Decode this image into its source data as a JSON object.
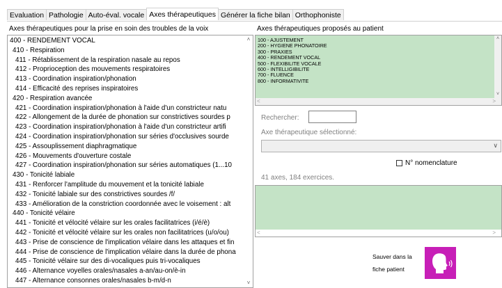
{
  "tabs": [
    {
      "label": "Evaluation",
      "active": false
    },
    {
      "label": "Pathologie",
      "active": false
    },
    {
      "label": "Auto-éval. vocale",
      "active": false
    },
    {
      "label": "Axes thérapeutiques",
      "active": true
    },
    {
      "label": "Générer la fiche bilan",
      "active": false
    },
    {
      "label": "Orthophoniste",
      "active": false
    }
  ],
  "left_panel": {
    "title": "Axes thérapeutiques pour la prise en soin des troubles de la voix",
    "items": [
      {
        "text": "400 - RENDEMENT VOCAL",
        "level": 0
      },
      {
        "text": "410 - Respiration",
        "level": 1
      },
      {
        "text": "411 - Rétablissement de la respiration nasale au repos",
        "level": 2
      },
      {
        "text": "412 - Proprioception des mouvements respiratoires",
        "level": 2
      },
      {
        "text": "413 - Coordination inspiration/phonation",
        "level": 2
      },
      {
        "text": "414 - Efficacité des reprises inspiratoires",
        "level": 2
      },
      {
        "text": "420 - Respiration avancée",
        "level": 1
      },
      {
        "text": "421 - Coordination inspiration/phonation à l'aide d'un constricteur natu",
        "level": 2
      },
      {
        "text": "422 - Allongement de la durée de phonation sur constrictives sourdes p",
        "level": 2
      },
      {
        "text": "423 - Coordination inspiration/phonation à l'aide d'un constricteur artifi",
        "level": 2
      },
      {
        "text": "424 - Coordination inspiration/phonation sur séries d'occlusives sourde",
        "level": 2
      },
      {
        "text": "425 - Assouplissement diaphragmatique",
        "level": 2
      },
      {
        "text": "426 - Mouvements d'ouverture costale",
        "level": 2
      },
      {
        "text": "427 - Coordination inspiration/phonation sur séries automatiques (1...10",
        "level": 2
      },
      {
        "text": "430 - Tonicité labiale",
        "level": 1
      },
      {
        "text": "431 - Renforcer l'amplitude du mouvement et la tonicité labiale",
        "level": 2
      },
      {
        "text": "432 - Tonicité labiale sur des constrictives sourdes /f/",
        "level": 2
      },
      {
        "text": "433 - Amélioration de la constriction coordonnée avec le voisement : alt",
        "level": 2
      },
      {
        "text": "440 - Tonicité vélaire",
        "level": 1
      },
      {
        "text": "441 - Tonicité et vélocité vélaire sur les orales facilitatrices (i/é/è)",
        "level": 2
      },
      {
        "text": "442 - Tonicité et vélocité vélaire sur les orales non facilitatrices (u/o/ou)",
        "level": 2
      },
      {
        "text": "443 - Prise de conscience de l'implication vélaire dans les attaques et fin",
        "level": 2
      },
      {
        "text": "444 - Prise de conscience de l'implication vélaire dans la durée de phona",
        "level": 2
      },
      {
        "text": "445 - Tonicité vélaire sur des di-vocaliques puis tri-vocaliques",
        "level": 2
      },
      {
        "text": "446 - Alternance voyelles orales/nasales a-an/au-on/è-in",
        "level": 2
      },
      {
        "text": "447 - Alternance consonnes orales/nasales b-m/d-n",
        "level": 2
      }
    ]
  },
  "right_panel": {
    "title": "Axes thérapeutiques proposés au patient",
    "proposed": [
      "100 - AJUSTEMENT",
      "200 - HYGIENE PHONATOIRE",
      "300 - PRAXIES",
      "400 - RENDEMENT VOCAL",
      "500 - FLEXIBILITE VOCALE",
      "600 - INTELLIGIBILITE",
      "700 - FLUENCE",
      "800 - INFORMATIVITE"
    ],
    "search_label": "Rechercher:",
    "search_value": "",
    "selected_label": "Axe thérapeutique sélectionné:",
    "selected_value": "",
    "nomenclature_label": "N° nomenclature",
    "count_text": "41 axes, 184 exercices.",
    "save_label_line1": "Sauver dans la",
    "save_label_line2": "fiche patient",
    "save_icon": "speaking-head-icon"
  },
  "colors": {
    "list_green": "#c4e3c6",
    "save_button": "#c71fb7"
  }
}
